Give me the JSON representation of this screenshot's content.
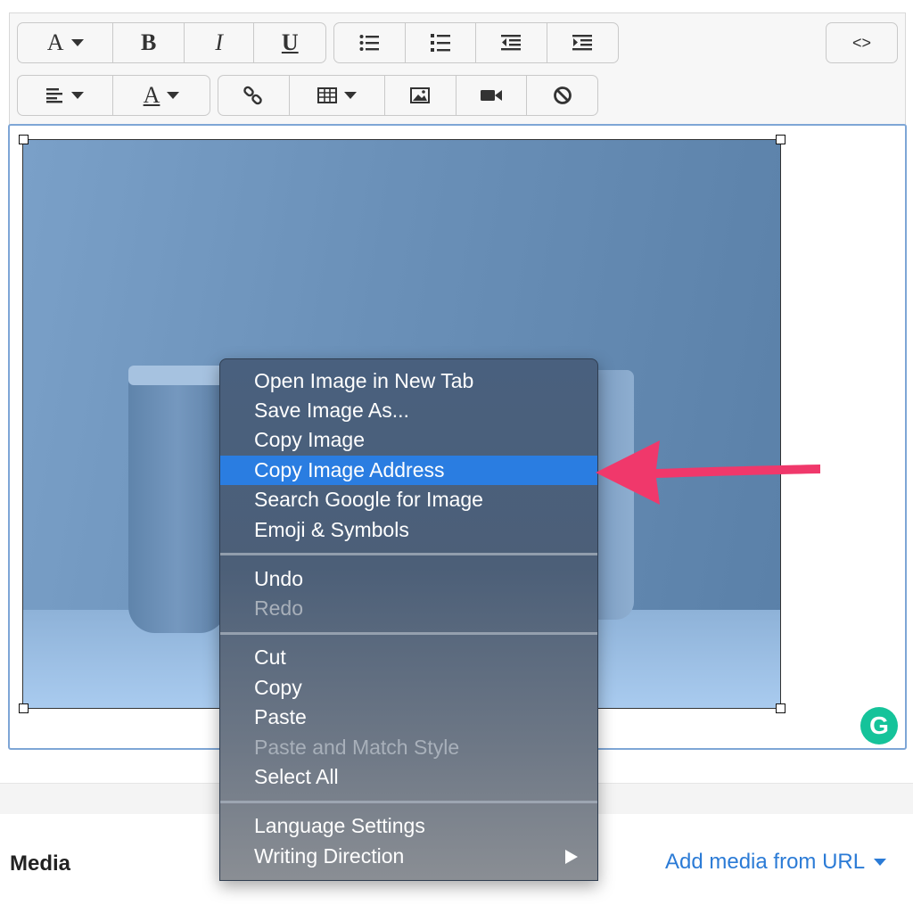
{
  "toolbar": {
    "row1": {
      "font_button": {
        "icon": "text-style-icon",
        "glyph": "A"
      },
      "bold_button": {
        "glyph": "B"
      },
      "italic_button": {
        "glyph": "I"
      },
      "underline_button": {
        "glyph": "U"
      },
      "unordered_list_icon": "bullet-list-icon",
      "ordered_list_icon": "numbered-list-icon",
      "outdent_icon": "outdent-icon",
      "indent_icon": "indent-icon",
      "html_button": {
        "glyph": "<>"
      }
    },
    "row2": {
      "align_icon": "align-left-icon",
      "text_color_button": {
        "glyph": "A"
      },
      "link_icon": "link-icon",
      "table_icon": "table-icon",
      "image_icon": "image-icon",
      "video_icon": "video-camera-icon",
      "clear_icon": "no-symbol-icon"
    }
  },
  "editor": {
    "grammarly_badge": "G"
  },
  "context_menu": {
    "groups": [
      [
        "Open Image in New Tab",
        "Save Image As...",
        "Copy Image",
        "Copy Image Address",
        "Search Google for Image",
        "Emoji & Symbols"
      ],
      [
        "Undo",
        "Redo"
      ],
      [
        "Cut",
        "Copy",
        "Paste",
        "Paste and Match Style",
        "Select All"
      ],
      [
        "Language Settings",
        "Writing Direction"
      ]
    ],
    "highlighted": "Copy Image Address",
    "disabled": [
      "Redo",
      "Paste and Match Style"
    ],
    "has_submenu": [
      "Writing Direction"
    ]
  },
  "annotation": {
    "arrow_color": "#f0386b"
  },
  "footer": {
    "media_label": "Media",
    "add_media_link": "Add media from URL"
  }
}
